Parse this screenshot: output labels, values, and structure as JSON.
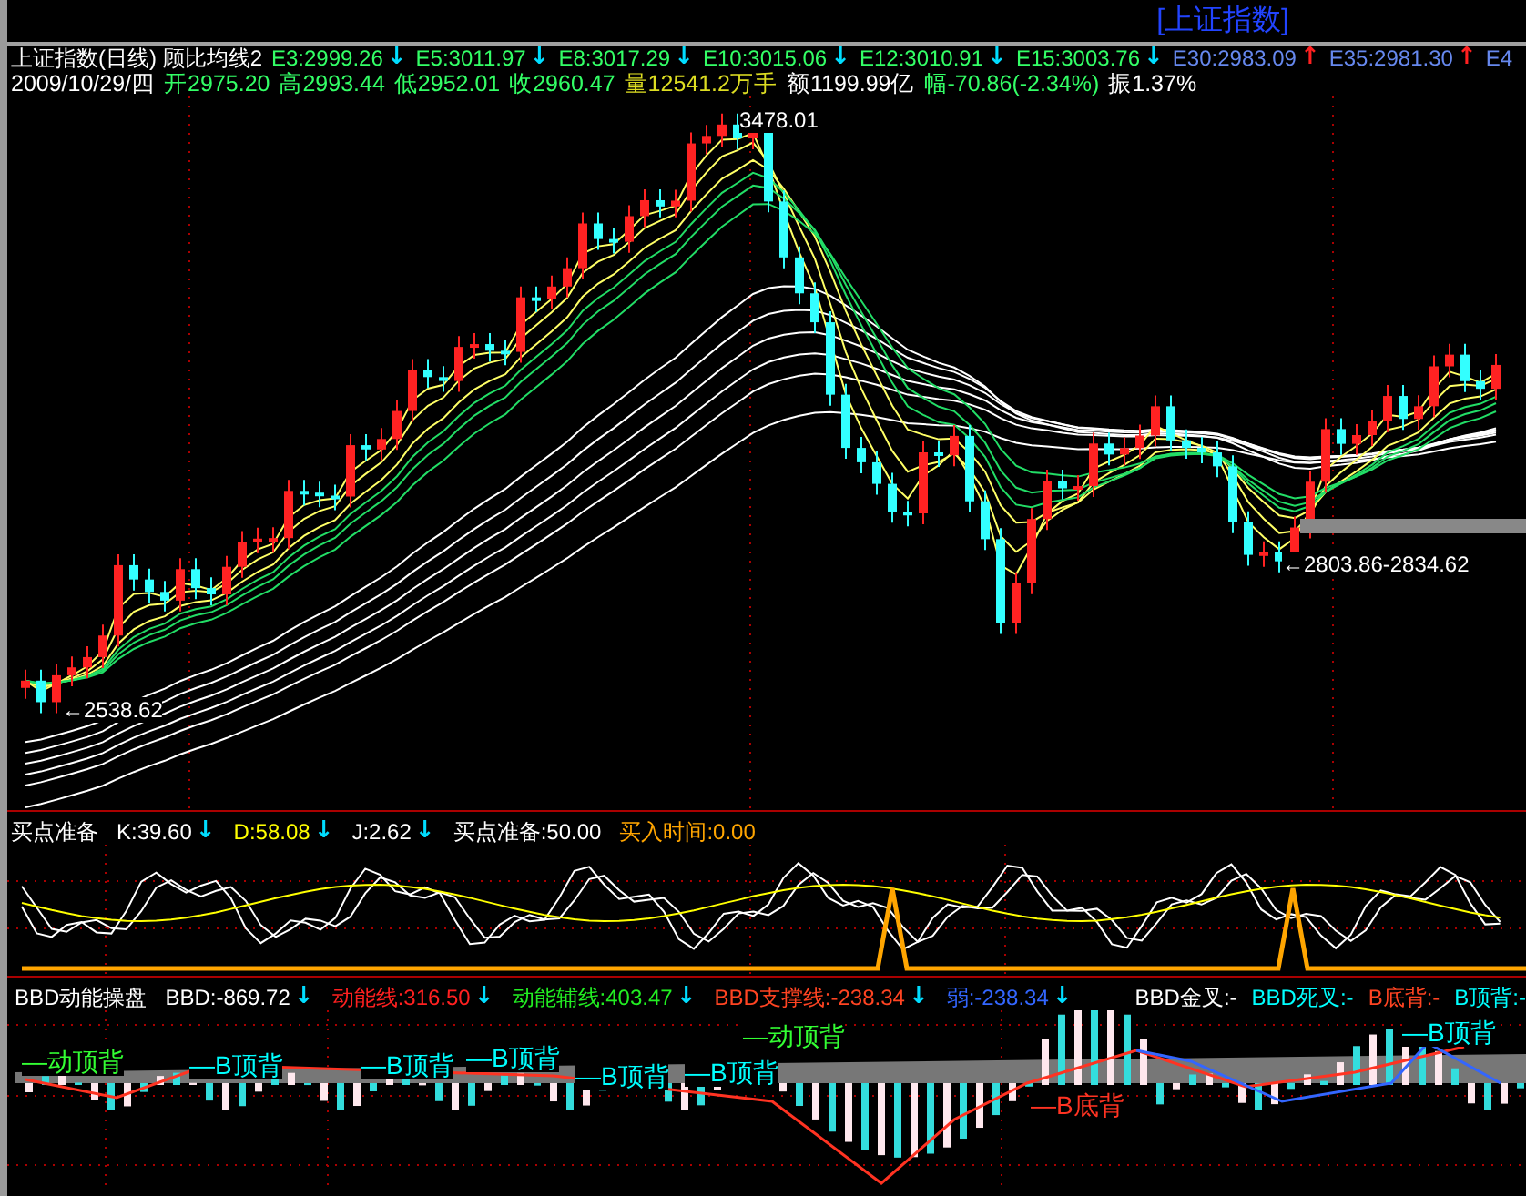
{
  "title_bar": {
    "title": "[上证指数]"
  },
  "main_panel": {
    "legend": [
      {
        "text": "上证指数(日线) 顾比均线2",
        "color": "#ffffff"
      },
      {
        "text": "E3:2999.26",
        "color": "#33ff66",
        "arrow": {
          "glyph": "↓",
          "color": "#00ddff"
        }
      },
      {
        "text": "E5:3011.97",
        "color": "#33ff66",
        "arrow": {
          "glyph": "↓",
          "color": "#00ddff"
        }
      },
      {
        "text": "E8:3017.29",
        "color": "#33ff66",
        "arrow": {
          "glyph": "↓",
          "color": "#00ddff"
        }
      },
      {
        "text": "E10:3015.06",
        "color": "#33ff66",
        "arrow": {
          "glyph": "↓",
          "color": "#00ddff"
        }
      },
      {
        "text": "E12:3010.91",
        "color": "#33ff66",
        "arrow": {
          "glyph": "↓",
          "color": "#00ddff"
        }
      },
      {
        "text": "E15:3003.76",
        "color": "#33ff66",
        "arrow": {
          "glyph": "↓",
          "color": "#00ddff"
        }
      },
      {
        "text": "E30:2983.09",
        "color": "#6688ee",
        "arrow": {
          "glyph": "↑",
          "color": "#ff2020"
        }
      },
      {
        "text": "E35:2981.30",
        "color": "#6688ee",
        "arrow": {
          "glyph": "↑",
          "color": "#ff2020"
        }
      },
      {
        "text": "E4",
        "color": "#6688ee"
      }
    ],
    "quote": [
      {
        "text": "2009/10/29/四",
        "color": "#ffffff"
      },
      {
        "text": "开2975.20",
        "color": "#33ff66"
      },
      {
        "text": "高2993.44",
        "color": "#33ff66"
      },
      {
        "text": "低2952.01",
        "color": "#33ff66"
      },
      {
        "text": "收2960.47",
        "color": "#33ff66"
      },
      {
        "text": "量12541.2万手",
        "color": "#dddd22"
      },
      {
        "text": "额1199.99亿",
        "color": "#ffffff"
      },
      {
        "text": "幅-70.86(-2.34%)",
        "color": "#33ff66"
      },
      {
        "text": "振1.37%",
        "color": "#ffffff"
      }
    ],
    "price_labels": [
      "3478.01",
      "←2803.86-2834.62",
      "←2538.62"
    ]
  },
  "kdj_panel": {
    "legend": [
      {
        "text": "买点准备",
        "color": "#ffffff"
      },
      {
        "text": "K:39.60",
        "color": "#ffffff",
        "arrow": {
          "glyph": "↓",
          "color": "#00ddff"
        }
      },
      {
        "text": "D:58.08",
        "color": "#ffff00",
        "arrow": {
          "glyph": "↓",
          "color": "#00ddff"
        }
      },
      {
        "text": "J:2.62",
        "color": "#ffffff",
        "arrow": {
          "glyph": "↓",
          "color": "#00ddff"
        }
      },
      {
        "text": "买点准备:50.00",
        "color": "#ffffff"
      },
      {
        "text": "买入时间:0.00",
        "color": "#ffa500"
      }
    ]
  },
  "bbd_panel": {
    "legend": [
      {
        "text": "BBD动能操盘",
        "color": "#ffffff"
      },
      {
        "text": "BBD:-869.72",
        "color": "#ffffff",
        "arrow": {
          "glyph": "↓",
          "color": "#00ddff"
        }
      },
      {
        "text": "动能线:316.50",
        "color": "#ff2020",
        "arrow": {
          "glyph": "↓",
          "color": "#00ddff"
        }
      },
      {
        "text": "动能辅线:403.47",
        "color": "#22ee22",
        "arrow": {
          "glyph": "↓",
          "color": "#00ddff"
        }
      },
      {
        "text": "BBD支撑线:-238.34",
        "color": "#ff4422",
        "arrow": {
          "glyph": "↓",
          "color": "#00ddff"
        }
      },
      {
        "text": "弱:-238.34",
        "color": "#3366ff",
        "arrow": {
          "glyph": "↓",
          "color": "#00ddff"
        }
      }
    ],
    "cross_legend": [
      {
        "text": "BBD金叉:-",
        "color": "#ffffff"
      },
      {
        "text": "BBD死叉:-",
        "color": "#00ffff"
      },
      {
        "text": "B底背:-",
        "color": "#ff4422"
      },
      {
        "text": "B顶背:-",
        "color": "#00ffff"
      }
    ],
    "signals": [
      {
        "text": "—动顶背",
        "color": "#33ff33"
      },
      {
        "text": "—B顶背",
        "color": "#00ffff"
      },
      {
        "text": "—B顶背",
        "color": "#00ffff"
      },
      {
        "text": "—B顶背",
        "color": "#00ffff"
      },
      {
        "text": "—B顶背",
        "color": "#00ffff"
      },
      {
        "text": "—B顶背",
        "color": "#00ffff"
      },
      {
        "text": "—动顶背",
        "color": "#33ff33"
      },
      {
        "text": "—B底背",
        "color": "#ff3322"
      },
      {
        "text": "—B顶背",
        "color": "#00ffff"
      }
    ]
  }
}
